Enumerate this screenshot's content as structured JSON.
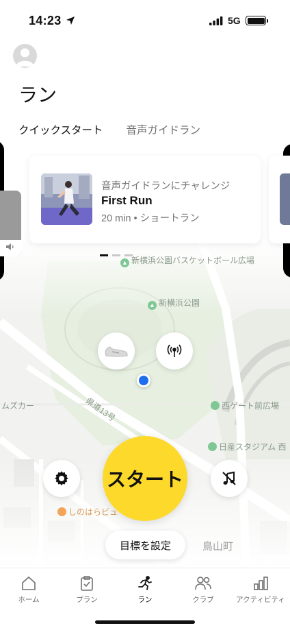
{
  "status_bar": {
    "time": "14:23",
    "network": "5G"
  },
  "header": {
    "title": "ラン",
    "tabs": [
      {
        "label": "クイックスタート",
        "active": true
      },
      {
        "label": "音声ガイドラン",
        "active": false
      }
    ]
  },
  "card": {
    "subtitle": "音声ガイドランにチャレンジ",
    "title": "First Run",
    "meta": "20 min • ショートラン"
  },
  "map": {
    "labels": [
      "新横浜公園バスケットボール広場",
      "新横浜公園",
      "西ゲート前広場",
      "日産スタジアム 西",
      "県道13号",
      "ムズカー",
      "しのはらビュ",
      "鳥山町"
    ]
  },
  "controls": {
    "start_label": "スタート",
    "goal_label": "目標を設定"
  },
  "bottom_nav": [
    {
      "label": "ホーム",
      "icon": "home-icon",
      "active": false
    },
    {
      "label": "プラン",
      "icon": "clipboard-icon",
      "active": false
    },
    {
      "label": "ラン",
      "icon": "runner-icon",
      "active": true
    },
    {
      "label": "クラブ",
      "icon": "people-icon",
      "active": false
    },
    {
      "label": "アクティビティ",
      "icon": "bar-chart-icon",
      "active": false
    }
  ],
  "colors": {
    "start": "#fdd92b",
    "location": "#1d6ff0",
    "map_park": "#e6efe0"
  }
}
